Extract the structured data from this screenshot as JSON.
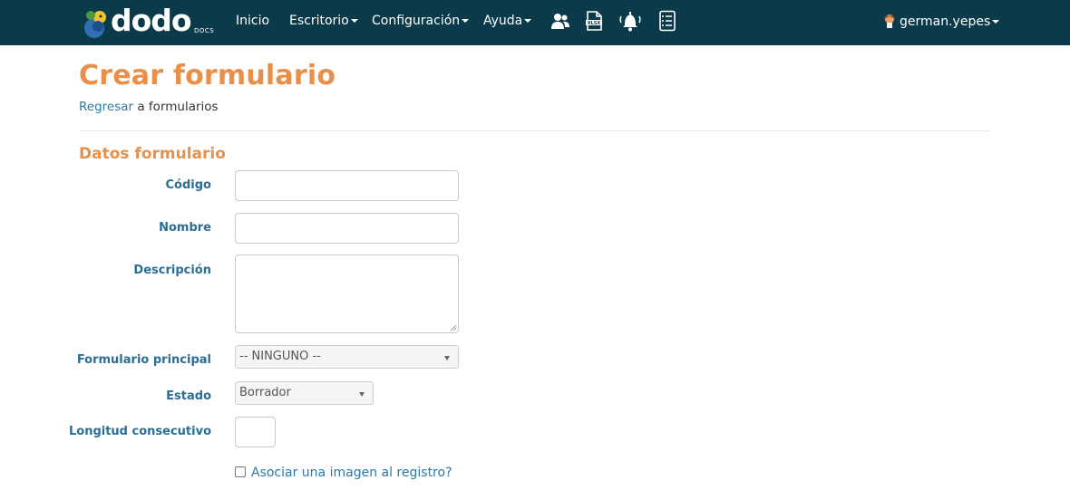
{
  "navbar": {
    "logo_text": "dodo",
    "logo_sub": "DOCS",
    "items": [
      {
        "label": "Inicio"
      },
      {
        "label": "Escritorio"
      },
      {
        "label": "Configuración"
      },
      {
        "label": "Ayuda"
      }
    ],
    "icons": [
      "users-icon",
      "xlsx-file-icon",
      "bell-icon",
      "report-list-icon"
    ],
    "user": "german.yepes"
  },
  "page": {
    "title": "Crear formulario",
    "back_link": "Regresar",
    "back_suffix": " a formularios",
    "section_title": "Datos formulario"
  },
  "form": {
    "codigo": {
      "label": "Código",
      "value": ""
    },
    "nombre": {
      "label": "Nombre",
      "value": ""
    },
    "descripcion": {
      "label": "Descripción",
      "value": ""
    },
    "formulario_principal": {
      "label": "Formulario principal",
      "selected": "-- NINGUNO --"
    },
    "estado": {
      "label": "Estado",
      "selected": "Borrador"
    },
    "longitud": {
      "label": "Longitud consecutivo",
      "value": ""
    },
    "imagen_checkbox": {
      "label": "Asociar una imagen al registro?",
      "checked": false
    }
  },
  "colors": {
    "navbar_bg": "#0b3b4a",
    "accent_orange": "#e8904a",
    "label_blue": "#2a6e96",
    "link_blue": "#2a7aa3"
  }
}
